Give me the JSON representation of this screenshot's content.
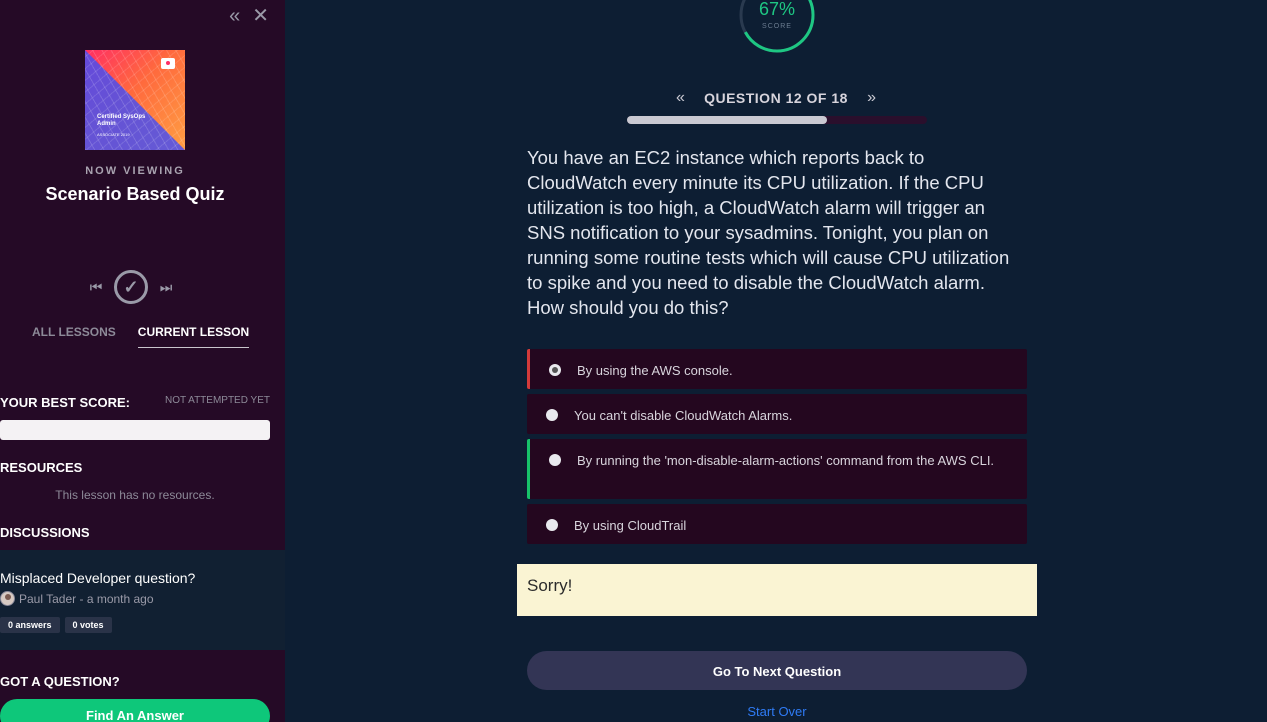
{
  "sidebar": {
    "course_thumb": {
      "title": "Certified SysOps Admin",
      "subtitle": "ASSOCIATE 2019"
    },
    "now_viewing": "NOW VIEWING",
    "quiz_title": "Scenario Based Quiz",
    "tabs": [
      {
        "label": "ALL LESSONS",
        "active": false
      },
      {
        "label": "CURRENT LESSON",
        "active": true
      }
    ],
    "best_score_label": "YOUR BEST SCORE:",
    "not_attempted": "NOT ATTEMPTED YET",
    "resources_label": "RESOURCES",
    "no_resources": "This lesson has no resources.",
    "discussions_label": "DISCUSSIONS",
    "discussion": {
      "title": "Misplaced Developer question?",
      "author_meta": "Paul Tader - a month ago",
      "answers": "0 answers",
      "votes": "0 votes"
    },
    "got_question": "GOT A QUESTION?",
    "find_answer": "Find An Answer"
  },
  "main": {
    "score_percent": "67%",
    "score_word": "SCORE",
    "score_value": 0.67,
    "question_label": "QUESTION 12 OF 18",
    "progress_fraction": 0.667,
    "question_text": "You have an EC2 instance which reports back to CloudWatch every minute its CPU utilization. If the CPU utilization is too high, a CloudWatch alarm will trigger an SNS notification to your sysadmins. Tonight, you plan on running some routine tests which will cause CPU utilization to spike and you need to disable the CloudWatch alarm. How should you do this?",
    "options": [
      {
        "text": "By using the AWS console.",
        "state": "wrong",
        "selected": true
      },
      {
        "text": "You can't disable CloudWatch Alarms.",
        "state": "",
        "selected": false
      },
      {
        "text": "By running the 'mon-disable-alarm-actions' command from the AWS CLI.",
        "state": "right",
        "selected": false
      },
      {
        "text": "By using CloudTrail",
        "state": "",
        "selected": false
      }
    ],
    "feedback": "Sorry!",
    "next_button": "Go To Next Question",
    "start_over": "Start Over"
  },
  "colors": {
    "sidebar_bg": "#250a26",
    "main_bg": "#0d1e33",
    "score_green": "#1ec783",
    "wrong_red": "#d33a3a",
    "right_green": "#17c26a",
    "find_green": "#0ec77a",
    "link_blue": "#2f7bf5"
  },
  "icons": [
    "double-chevron-left-icon",
    "close-icon",
    "skip-previous-icon",
    "check-circle-icon",
    "skip-next-icon"
  ]
}
